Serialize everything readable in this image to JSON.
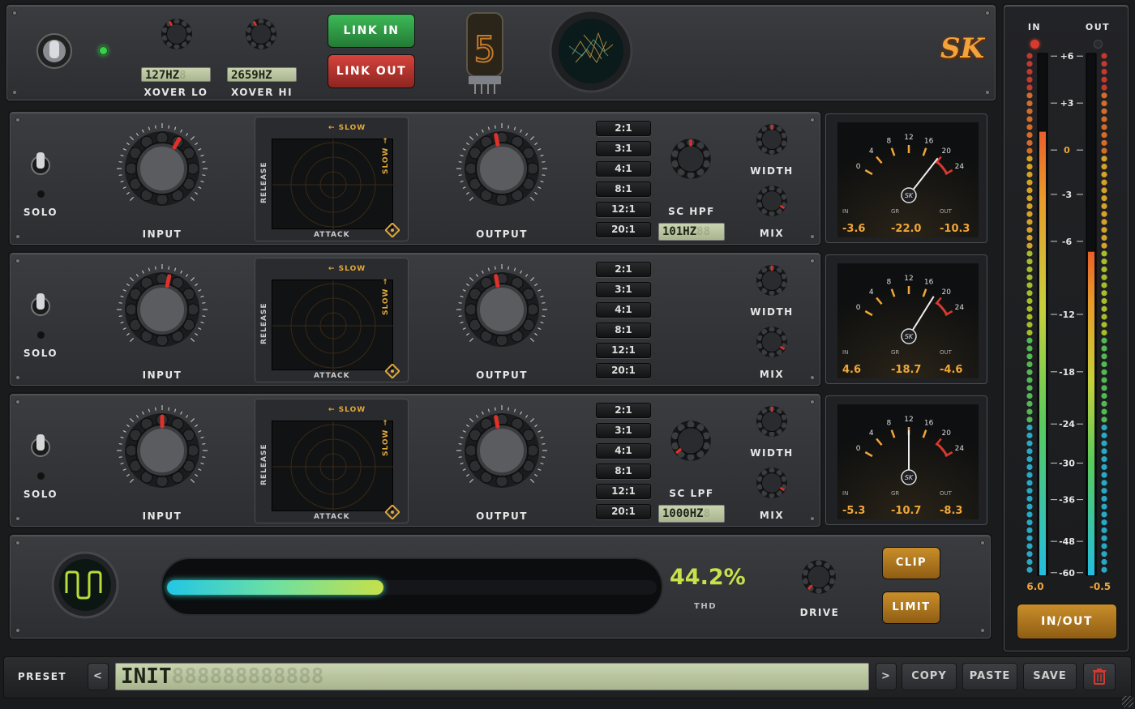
{
  "header": {
    "xover_lo_value": "127HZ",
    "xover_lo_ghost": "8",
    "xover_lo_label": "XOVER LO",
    "xover_hi_value": "2659HZ",
    "xover_hi_label": "XOVER HI",
    "link_in_label": "LINK IN",
    "link_out_label": "LINK OUT",
    "nixie_digit": "5",
    "logo_text": "SK"
  },
  "bands": [
    {
      "solo_label": "SOLO",
      "input_label": "INPUT",
      "output_label": "OUTPUT",
      "xy": {
        "slow": "← SLOW",
        "slow_side": "SLOW →",
        "release": "RELEASE",
        "attack": "ATTACK"
      },
      "ratios": [
        "2:1",
        "3:1",
        "4:1",
        "8:1",
        "12:1",
        "20:1"
      ],
      "sc_label": "SC HPF",
      "sc_value": "101HZ",
      "sc_ghost": "88",
      "width_label": "WIDTH",
      "mix_label": "MIX",
      "meter": {
        "in": "-3.6",
        "gr": "-22.0",
        "out": "-10.3",
        "in_lbl": "IN",
        "gr_lbl": "GR",
        "out_lbl": "OUT"
      }
    },
    {
      "solo_label": "SOLO",
      "input_label": "INPUT",
      "output_label": "OUTPUT",
      "xy": {
        "slow": "← SLOW",
        "slow_side": "SLOW →",
        "release": "RELEASE",
        "attack": "ATTACK"
      },
      "ratios": [
        "2:1",
        "3:1",
        "4:1",
        "8:1",
        "12:1",
        "20:1"
      ],
      "width_label": "WIDTH",
      "mix_label": "MIX",
      "meter": {
        "in": "4.6",
        "gr": "-18.7",
        "out": "-4.6",
        "in_lbl": "IN",
        "gr_lbl": "GR",
        "out_lbl": "OUT"
      }
    },
    {
      "solo_label": "SOLO",
      "input_label": "INPUT",
      "output_label": "OUTPUT",
      "xy": {
        "slow": "← SLOW",
        "slow_side": "SLOW →",
        "release": "RELEASE",
        "attack": "ATTACK"
      },
      "ratios": [
        "2:1",
        "3:1",
        "4:1",
        "8:1",
        "12:1",
        "20:1"
      ],
      "sc_label": "SC LPF",
      "sc_value": "1000HZ",
      "sc_ghost": "8",
      "width_label": "WIDTH",
      "mix_label": "MIX",
      "meter": {
        "in": "-5.3",
        "gr": "-10.7",
        "out": "-8.3",
        "in_lbl": "IN",
        "gr_lbl": "GR",
        "out_lbl": "OUT"
      }
    }
  ],
  "vu_scale": [
    "0",
    "4",
    "8",
    "12",
    "16",
    "20",
    "24"
  ],
  "drive": {
    "thd_value": "44.2%",
    "thd_label": "THD",
    "drive_label": "DRIVE",
    "clip_label": "CLIP",
    "limit_label": "LIMIT",
    "thd_fraction": 0.442
  },
  "output_meter": {
    "in_label": "IN",
    "out_label": "OUT",
    "scale": [
      "+6",
      "+3",
      "0",
      "-3",
      "-6",
      "-12",
      "-18",
      "-24",
      "-30",
      "-36",
      "-48",
      "-60"
    ],
    "in_value": "6.0",
    "out_value": "-0.5",
    "inout_label": "IN/OUT",
    "in_level": 0.85,
    "out_level": 0.62
  },
  "preset_bar": {
    "preset_label": "PRESET",
    "prev": "<",
    "next": ">",
    "preset_name": "INIT",
    "preset_ghost": "888888888888",
    "copy": "COPY",
    "paste": "PASTE",
    "save": "SAVE"
  },
  "colors": {
    "accent_orange": "#f0a63a",
    "thd_green": "#c8e04a",
    "link_in": "#2f9a45",
    "link_out": "#b8302a"
  }
}
